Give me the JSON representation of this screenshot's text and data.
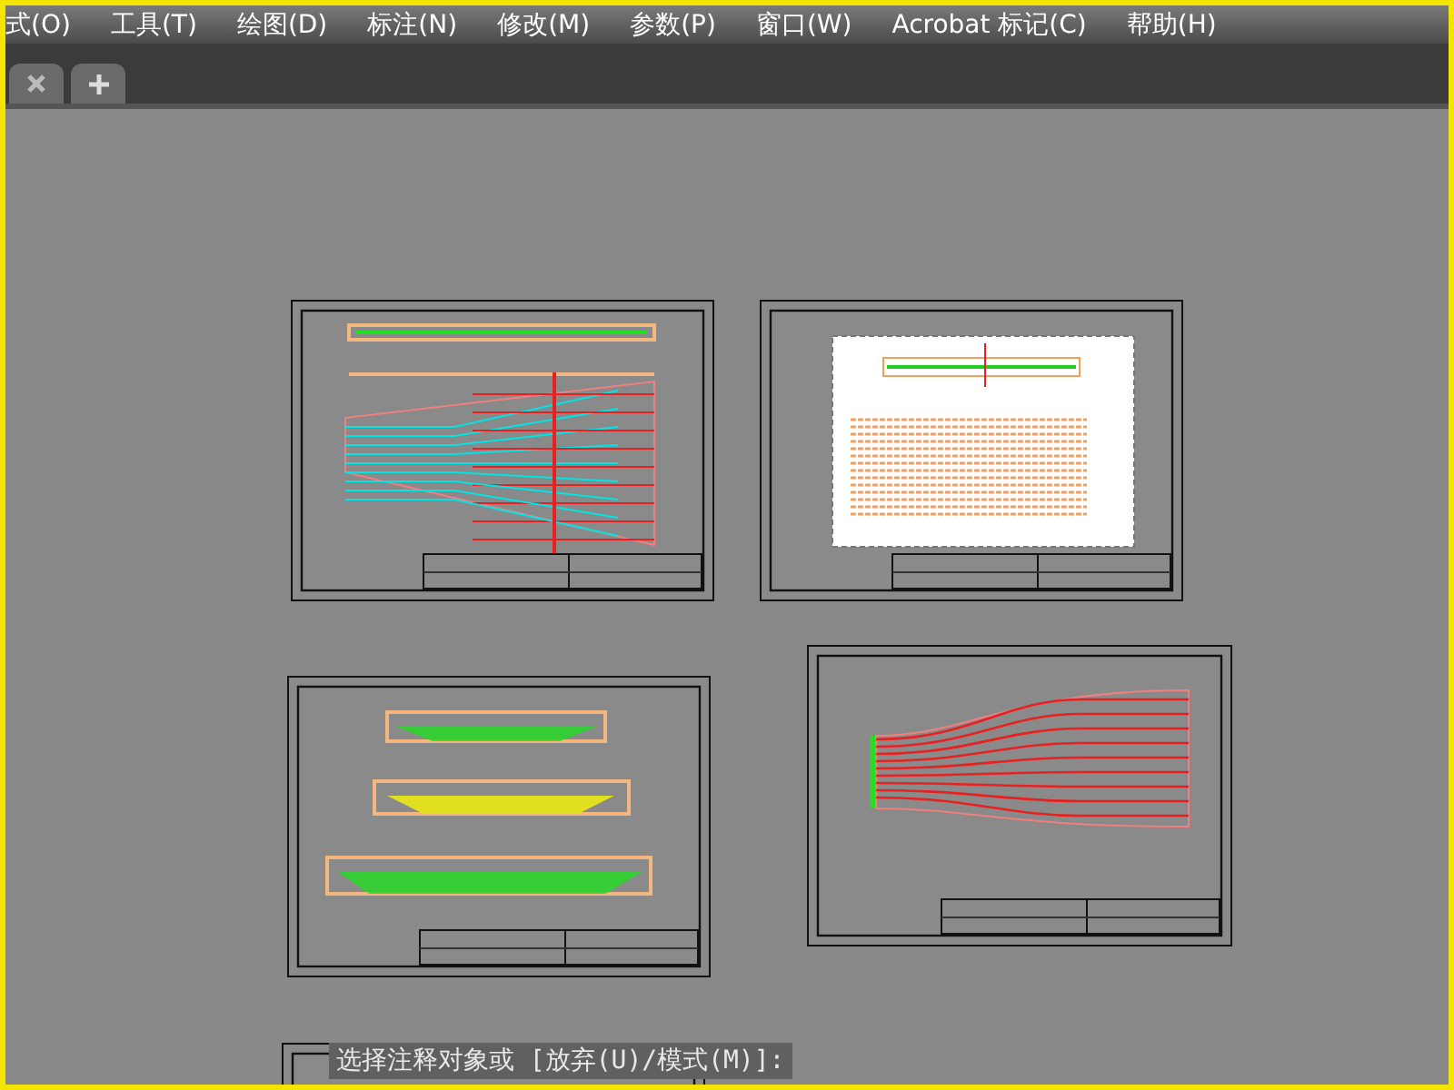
{
  "menu_bar": {
    "items": [
      {
        "label": "式(O)"
      },
      {
        "label": "工具(T)"
      },
      {
        "label": "绘图(D)"
      },
      {
        "label": "标注(N)"
      },
      {
        "label": "修改(M)"
      },
      {
        "label": "参数(P)"
      },
      {
        "label": "窗口(W)"
      },
      {
        "label": "Acrobat 标记(C)"
      },
      {
        "label": "帮助(H)"
      }
    ]
  },
  "command_line": {
    "prompt": "选择注释对象或 [放弃(U)/模式(M)]:"
  }
}
